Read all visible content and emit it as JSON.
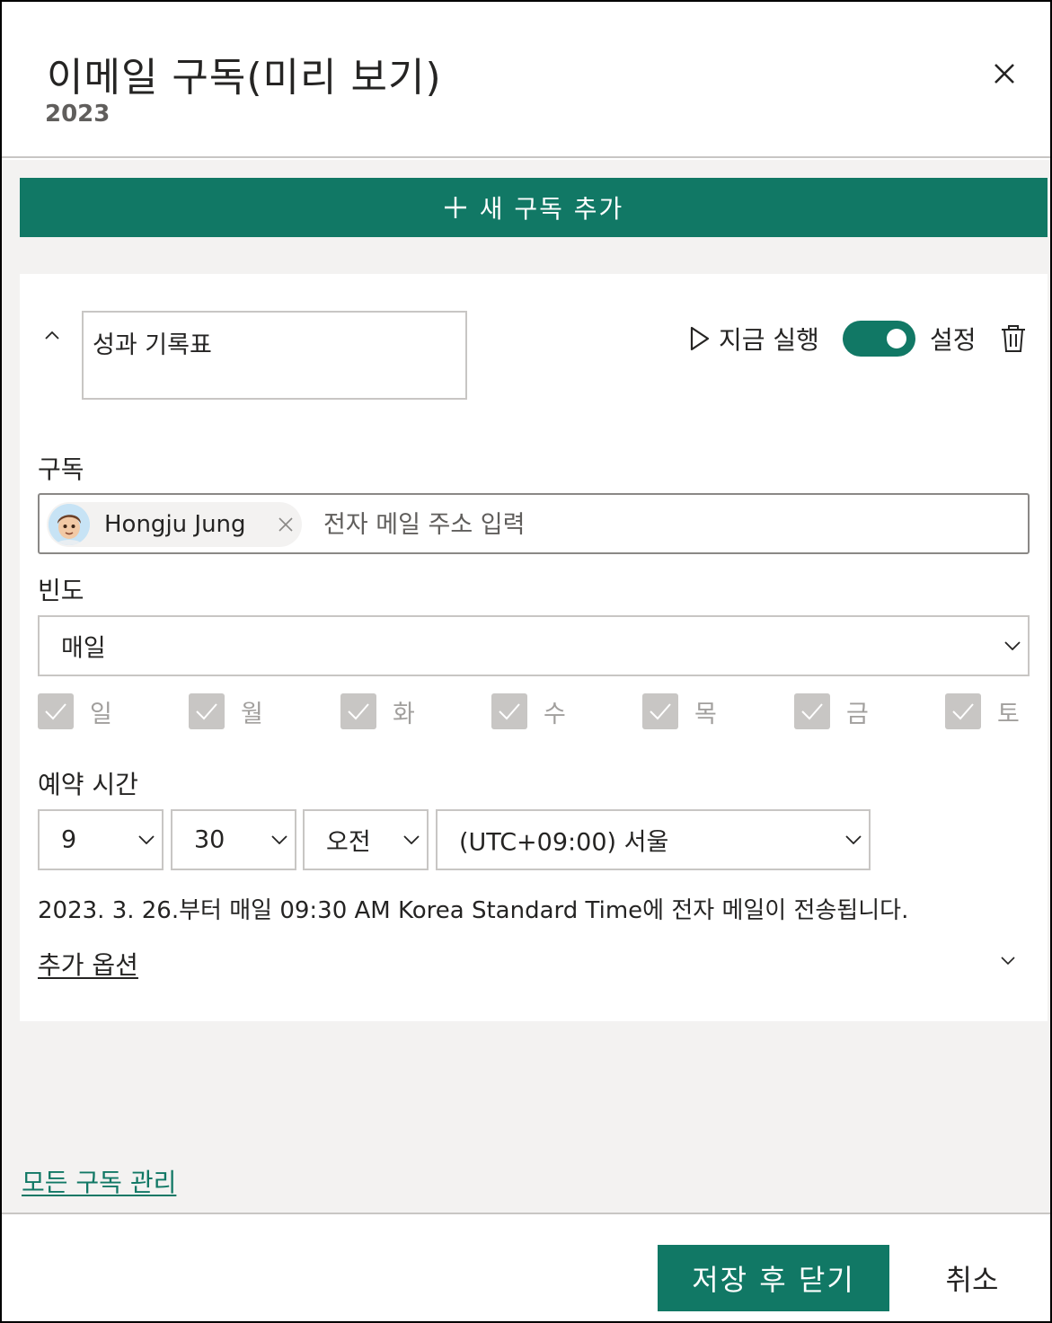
{
  "header": {
    "title": "이메일 구독(미리 보기)",
    "subtitle": "2023"
  },
  "add_subscription_label": "새 구독 추가",
  "subscription": {
    "name": "성과 기록표",
    "run_now_label": "지금 실행",
    "toggle_on": true,
    "toggle_label": "설정",
    "recipients_label": "구독",
    "recipient": {
      "name": "Hongju Jung"
    },
    "email_placeholder": "전자 메일 주소 입력",
    "frequency_label": "빈도",
    "frequency_value": "매일",
    "days": [
      {
        "label": "일",
        "checked": true
      },
      {
        "label": "월",
        "checked": true
      },
      {
        "label": "화",
        "checked": true
      },
      {
        "label": "수",
        "checked": true
      },
      {
        "label": "목",
        "checked": true
      },
      {
        "label": "금",
        "checked": true
      },
      {
        "label": "토",
        "checked": true
      }
    ],
    "schedule_label": "예약 시간",
    "hour": "9",
    "minute": "30",
    "ampm": "오전",
    "timezone": "(UTC+09:00) 서울",
    "schedule_note": "2023. 3. 26.부터 매일 09:30 AM Korea Standard Time에 전자 메일이 전송됩니다.",
    "more_options_label": "추가 옵션"
  },
  "manage_link": "모든 구독 관리",
  "footer": {
    "save_label": "저장 후 닫기",
    "cancel_label": "취소"
  },
  "colors": {
    "accent": "#117865",
    "panel_background": "#f3f2f1",
    "checkbox_disabled": "#c8c6c4"
  },
  "icons": [
    "close-icon",
    "plus-icon",
    "chevron-up-icon",
    "play-icon",
    "trash-icon",
    "chevron-down-icon",
    "checkmark-icon",
    "avatar"
  ]
}
